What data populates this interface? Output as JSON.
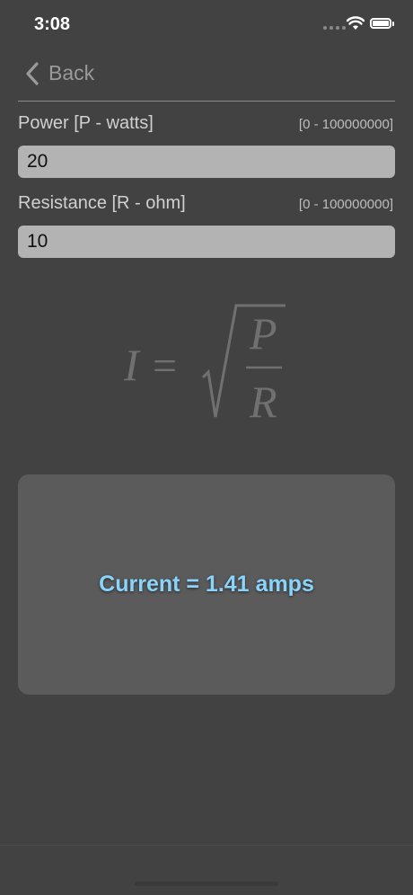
{
  "status_bar": {
    "time": "3:08"
  },
  "nav": {
    "back_label": "Back"
  },
  "power": {
    "label": "Power [P - watts]",
    "range": "[0 - 100000000]",
    "value": "20"
  },
  "resistance": {
    "label": "Resistance [R - ohm]",
    "range": "[0 - 100000000]",
    "value": "10"
  },
  "formula": {
    "lhs": "I",
    "equals": "=",
    "numerator": "P",
    "denominator": "R"
  },
  "result": {
    "text": "Current = 1.41 amps"
  },
  "colors": {
    "background": "#424242",
    "result_text": "#8ad4fb",
    "input_bg": "#b3b3b3",
    "card_bg": "#5b5b5b"
  }
}
